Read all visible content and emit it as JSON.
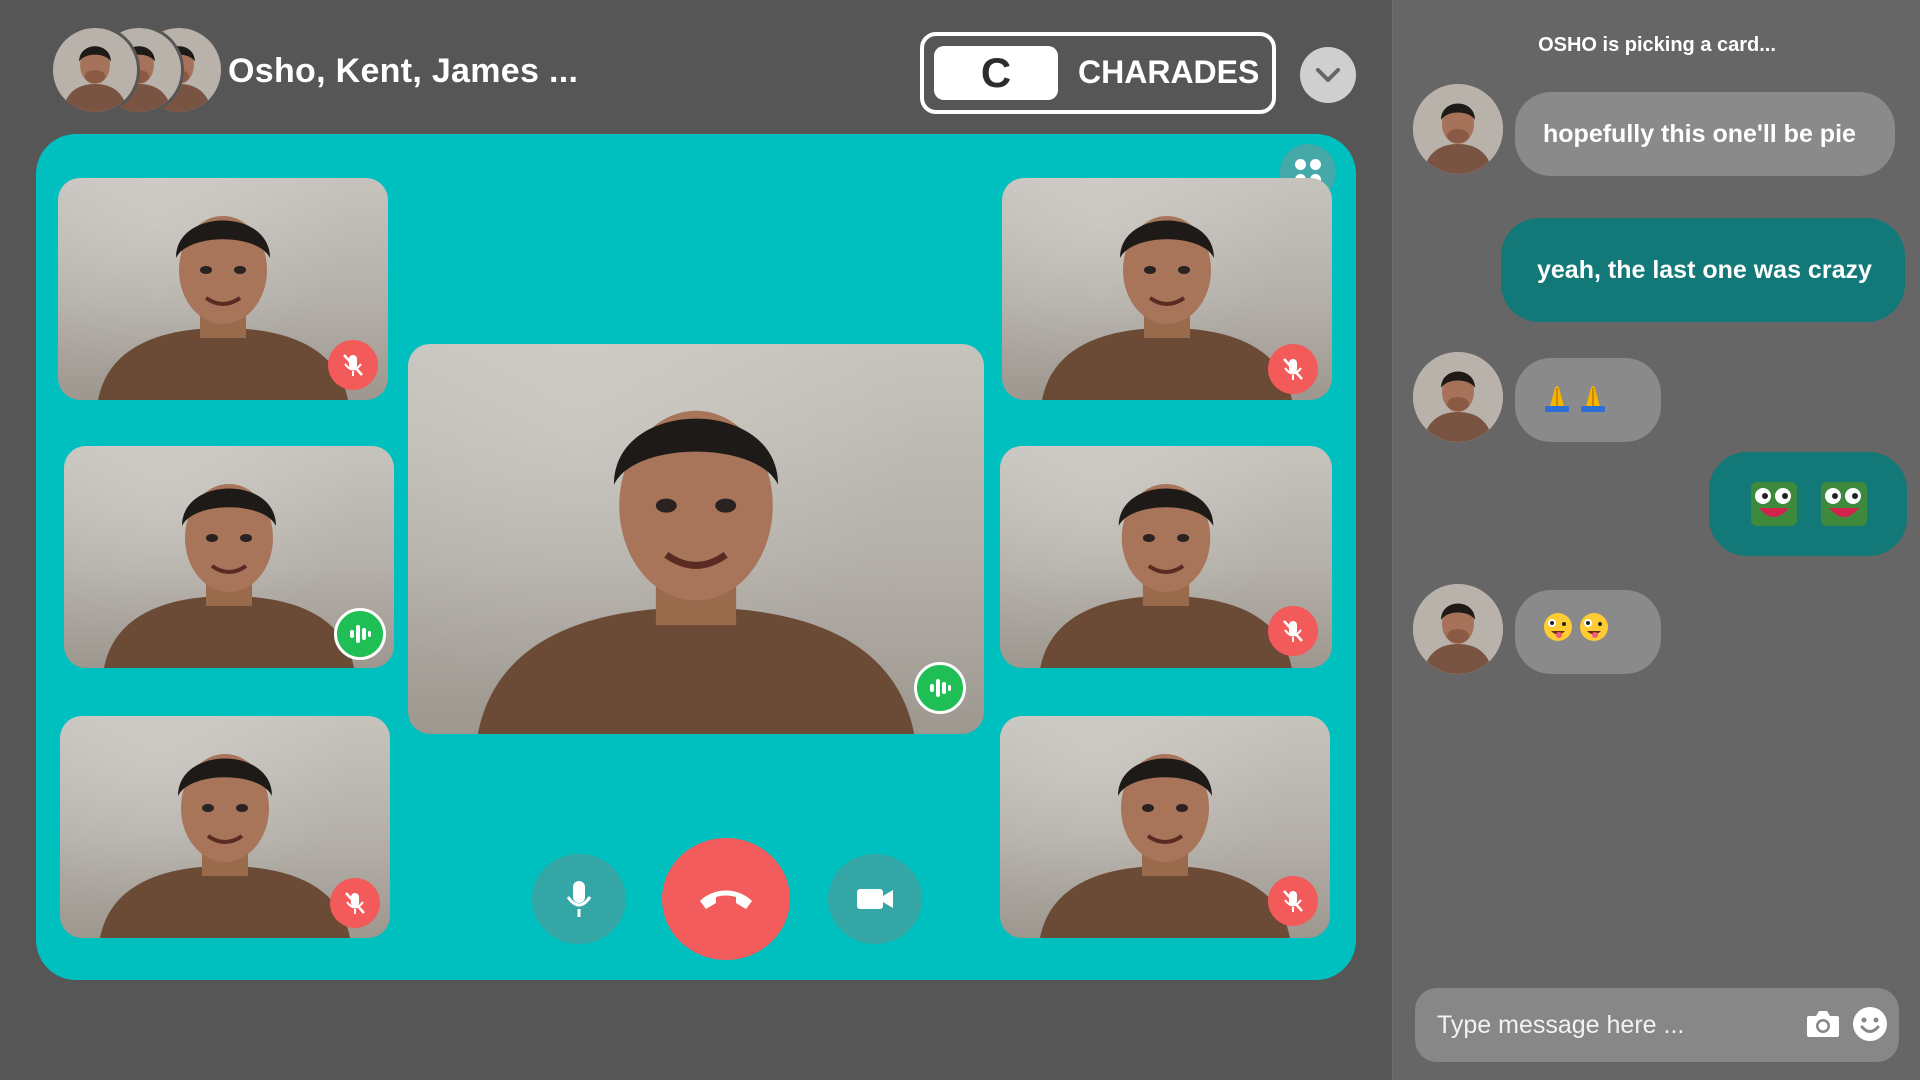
{
  "header": {
    "group_name": "Osho, Kent, James ...",
    "participant_avatars": [
      "avatar-1",
      "avatar-2",
      "avatar-3"
    ]
  },
  "game": {
    "letter": "C",
    "name": "CHARADES"
  },
  "call": {
    "tiles": [
      {
        "id": "participant-1",
        "status": "muted"
      },
      {
        "id": "participant-2",
        "status": "speaking"
      },
      {
        "id": "participant-3",
        "status": "muted"
      },
      {
        "id": "participant-main",
        "status": "speaking"
      },
      {
        "id": "participant-5",
        "status": "muted"
      },
      {
        "id": "participant-6",
        "status": "muted"
      },
      {
        "id": "participant-7",
        "status": "muted"
      }
    ],
    "controls": [
      "microphone-icon",
      "hang-up-icon",
      "video-camera-icon"
    ]
  },
  "chat": {
    "status": "OSHO is picking a card...",
    "messages": [
      {
        "direction": "in",
        "text": "hopefully this one'll be pie"
      },
      {
        "direction": "out",
        "text": "yeah, the last one was crazy"
      },
      {
        "direction": "in",
        "emojis": [
          "folded-hands-emoji",
          "folded-hands-emoji"
        ]
      },
      {
        "direction": "out",
        "emojis": [
          "pepe-emote",
          "pepe-emote"
        ]
      },
      {
        "direction": "in",
        "emojis": [
          "zany-face-emoji",
          "zany-face-emoji"
        ]
      }
    ],
    "composer": {
      "placeholder": "Type message here ...",
      "value": ""
    }
  },
  "colors": {
    "background": "#565656",
    "sidebar": "#666666",
    "call_panel": "#00bfbf",
    "outgoing_bubble": "#127878",
    "incoming_bubble": "#8a8a8a",
    "mute_red": "#f35a5a",
    "speaking_green": "#1fbf55",
    "hang_up_red": "#f25c5c"
  }
}
